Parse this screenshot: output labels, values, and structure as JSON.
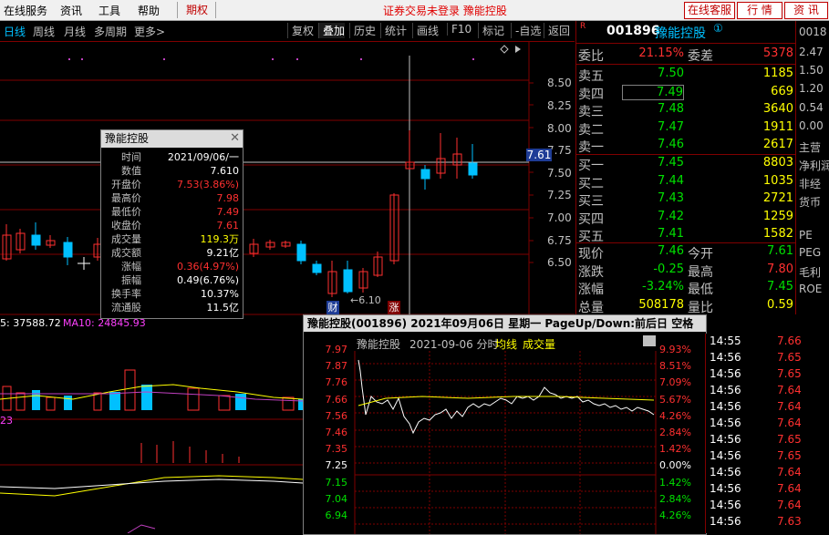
{
  "menubar": {
    "items": [
      "在线服务",
      "资讯",
      "工具",
      "帮助"
    ],
    "qiquan": "期权",
    "status": "证券交易未登录  豫能控股",
    "btn_kefu": "在线客服",
    "btn_hangqing": "行 情",
    "btn_zixun": "资 讯"
  },
  "period_bar": {
    "periods": [
      "日线",
      "周线",
      "月线",
      "多周期",
      "更多>"
    ],
    "tools": [
      "复权",
      "叠加",
      "历史",
      "统计",
      "画线",
      "F10",
      "标记",
      "-自选",
      "返回"
    ]
  },
  "kchart": {
    "price_labels": [
      "8.50",
      "8.25",
      "8.00",
      "7.75",
      "7.50",
      "7.25",
      "7.00",
      "6.75",
      "6.50"
    ],
    "current_price_tag": "7.61",
    "low_annotation": "6.10",
    "marker_cai": "财",
    "marker_zhang": "涨",
    "ma_label_5": "5: 37588.72",
    "ma_label_10": "MA10: 24845.93",
    "sub_label": "23"
  },
  "tooltip": {
    "title": "豫能控股",
    "rows": [
      {
        "k": "时间",
        "v": "2021/09/06/一",
        "c": "white"
      },
      {
        "k": "数值",
        "v": "7.610",
        "c": "white"
      },
      {
        "k": "开盘价",
        "v": "7.53(3.86%)",
        "c": "red"
      },
      {
        "k": "最高价",
        "v": "7.98",
        "c": "red"
      },
      {
        "k": "最低价",
        "v": "7.49",
        "c": "red"
      },
      {
        "k": "收盘价",
        "v": "7.61",
        "c": "red"
      },
      {
        "k": "成交量",
        "v": "119.3万",
        "c": "yellow"
      },
      {
        "k": "成交额",
        "v": "9.21亿",
        "c": "white"
      },
      {
        "k": "涨幅",
        "v": "0.36(4.97%)",
        "c": "red"
      },
      {
        "k": "振幅",
        "v": "0.49(6.76%)",
        "c": "white"
      },
      {
        "k": "换手率",
        "v": "10.37%",
        "c": "white"
      },
      {
        "k": "流通股",
        "v": "11.5亿",
        "c": "white"
      }
    ]
  },
  "quote": {
    "code": "001896",
    "name": "豫能控股",
    "badge": "①",
    "r_mark": "R",
    "weibi_label": "委比",
    "weibi": "21.15%",
    "weicha_label": "委差",
    "weicha": "5378",
    "asks": [
      {
        "label": "卖五",
        "price": "7.50",
        "vol": "1185"
      },
      {
        "label": "卖四",
        "price": "7.49",
        "vol": "669"
      },
      {
        "label": "卖三",
        "price": "7.48",
        "vol": "3640"
      },
      {
        "label": "卖二",
        "price": "7.47",
        "vol": "1911"
      },
      {
        "label": "卖一",
        "price": "7.46",
        "vol": "2617"
      }
    ],
    "bids": [
      {
        "label": "买一",
        "price": "7.45",
        "vol": "8803"
      },
      {
        "label": "买二",
        "price": "7.44",
        "vol": "1035"
      },
      {
        "label": "买三",
        "price": "7.43",
        "vol": "2721"
      },
      {
        "label": "买四",
        "price": "7.42",
        "vol": "1259"
      },
      {
        "label": "买五",
        "price": "7.41",
        "vol": "1582"
      }
    ],
    "stats": [
      {
        "k1": "现价",
        "v1": "7.46",
        "c1": "green",
        "k2": "今开",
        "v2": "7.61",
        "c2": "green"
      },
      {
        "k1": "涨跌",
        "v1": "-0.25",
        "c1": "green",
        "k2": "最高",
        "v2": "7.80",
        "c2": "red"
      },
      {
        "k1": "涨幅",
        "v1": "-3.24%",
        "c1": "green",
        "k2": "最低",
        "v2": "7.45",
        "c2": "green"
      },
      {
        "k1": "总量",
        "v1": "508178",
        "c1": "yellow",
        "k2": "量比",
        "v2": "0.59",
        "c2": "yellow"
      }
    ]
  },
  "far_right": {
    "lines": [
      "0018",
      "2.47",
      "1.50",
      "1.20",
      "0.54",
      "0.00",
      "",
      "主营",
      "净利润",
      "非经",
      "货币",
      "",
      "PE",
      "PEG",
      "毛利",
      "ROE"
    ]
  },
  "intraday": {
    "title": "豫能控股(001896)  2021年09月06日 星期一  PageUp/Down:前后日  空格键:操作",
    "header_name": "豫能控股",
    "header_date": "2021-09-06 分时",
    "header_avg": "均线",
    "header_vol": "成交量",
    "left_axis": [
      "7.97",
      "7.87",
      "7.76",
      "7.66",
      "7.56",
      "7.46",
      "7.35",
      "7.25",
      "7.15",
      "7.04",
      "6.94"
    ],
    "right_axis": [
      "9.93%",
      "8.51%",
      "7.09%",
      "5.67%",
      "4.26%",
      "2.84%",
      "1.42%",
      "0.00%",
      "1.42%",
      "2.84%",
      "4.26%"
    ]
  },
  "ticks": [
    {
      "t": "14:55",
      "p": "7.66"
    },
    {
      "t": "14:56",
      "p": "7.65"
    },
    {
      "t": "14:56",
      "p": "7.65"
    },
    {
      "t": "14:56",
      "p": "7.64"
    },
    {
      "t": "14:56",
      "p": "7.64"
    },
    {
      "t": "14:56",
      "p": "7.64"
    },
    {
      "t": "14:56",
      "p": "7.65"
    },
    {
      "t": "14:56",
      "p": "7.65"
    },
    {
      "t": "14:56",
      "p": "7.64"
    },
    {
      "t": "14:56",
      "p": "7.64"
    },
    {
      "t": "14:56",
      "p": "7.64"
    },
    {
      "t": "14:56",
      "p": "7.63"
    }
  ]
}
